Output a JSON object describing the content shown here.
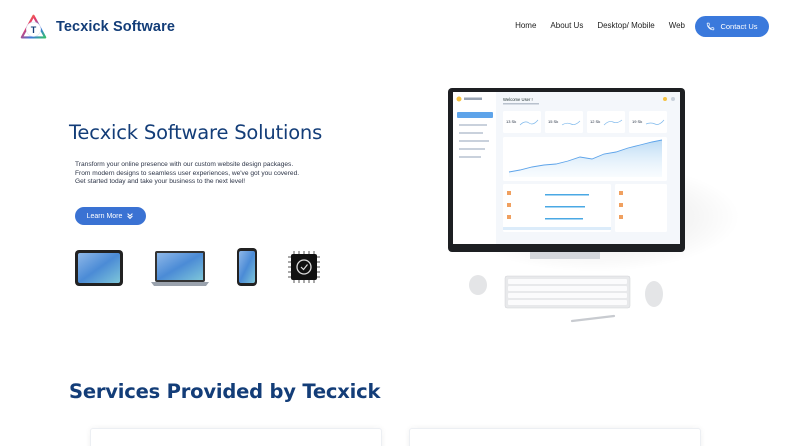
{
  "brand": {
    "name": "Tecxick Software",
    "logo_letter": "T"
  },
  "nav": {
    "links": [
      "Home",
      "About Us",
      "Desktop/ Mobile",
      "Web"
    ],
    "contact_label": "Contact Us"
  },
  "hero": {
    "title": "Tecxick Software Solutions",
    "desc_lines": [
      "Transform your online presence with our custom website design packages.",
      "From modern designs to seamless user experiences, we've got you covered.",
      "Get started today and take your business to the next level!"
    ],
    "cta_label": "Learn More"
  },
  "devices": [
    "tablet",
    "laptop",
    "phone",
    "chip"
  ],
  "dashboard": {
    "welcome": "Welcome User !",
    "stats": [
      "13 Sk",
      "15 Sk",
      "12 Sk",
      "19 Sk"
    ]
  },
  "services": {
    "title": "Services Provided by Tecxick"
  },
  "colors": {
    "primary": "#133d78",
    "accent": "#3a79dc"
  }
}
